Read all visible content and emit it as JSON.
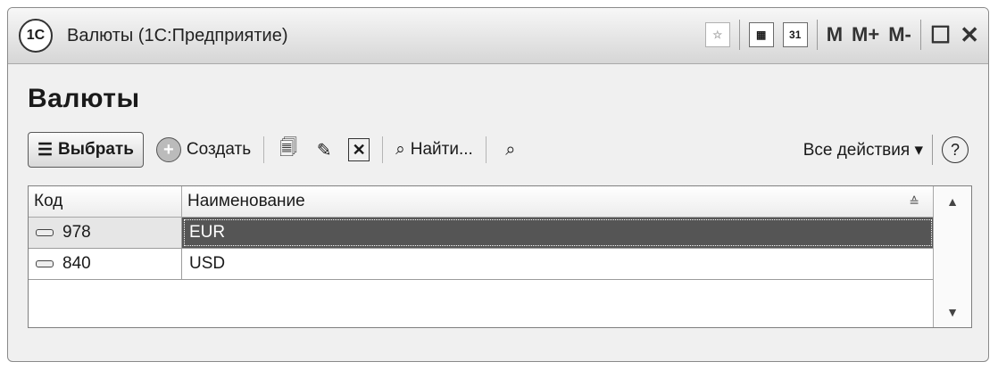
{
  "window": {
    "logo_text": "1С",
    "title": "Валюты  (1С:Предприятие)",
    "icons": [
      "bookmark-icon",
      "calculator-icon",
      "calendar-icon"
    ],
    "calendar_number": "31",
    "memory_labels": [
      "M",
      "M+",
      "M-"
    ],
    "maximize_label": "☐",
    "close_label": "✕"
  },
  "page": {
    "heading": "Валюты"
  },
  "toolbar": {
    "select_label": "Выбрать",
    "create_label": "Создать",
    "find_label": "Найти...",
    "all_actions_label": "Все действия ▾",
    "help_label": "?"
  },
  "table": {
    "columns": [
      "Код",
      "Наименование"
    ],
    "rows": [
      {
        "code": "978",
        "name": "EUR",
        "selected": true
      },
      {
        "code": "840",
        "name": "USD",
        "selected": false
      }
    ]
  }
}
